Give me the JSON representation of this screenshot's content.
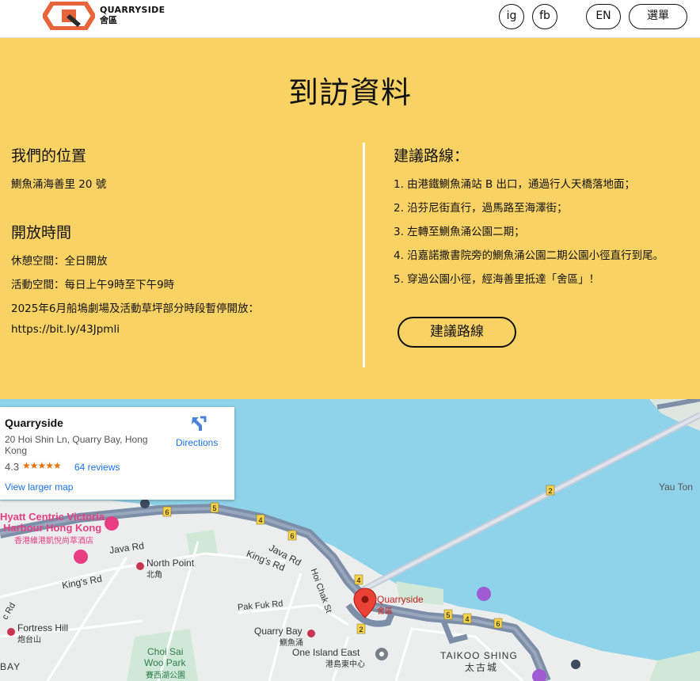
{
  "header": {
    "logo_line1": "QUARRYSIDE",
    "logo_line2": "舍區",
    "ig_label": "ig",
    "fb_label": "fb",
    "lang_label": "EN",
    "menu_label": "選單"
  },
  "info": {
    "title": "到訪資料",
    "location_heading": "我們的位置",
    "location_text": "鰂魚涌海善里 20 號",
    "hours_heading": "開放時間",
    "hours_lines": [
      "休憩空間：全日開放",
      "活動空間：每日上午9時至下午9時",
      "2025年6月船塢劇場及活動草坪部分時段暫停開放：",
      "https://bit.ly/43Jpmli"
    ],
    "route_heading": "建議路線：",
    "route_steps": [
      "1. 由港鐵鰂魚涌站 B 出口，通過行人天橋落地面；",
      "2. 沿芬尼街直行，過馬路至海澤街；",
      "3. 左轉至鰂魚涌公園二期；",
      "4. 沿嘉諾撒書院旁的鰂魚涌公園二期公園小徑直行到尾。",
      "5. 穿過公園小徑，經海善里抵達「舍區」！"
    ],
    "route_button": "建議路線"
  },
  "map": {
    "card": {
      "name": "Quarryside",
      "address": "20 Hoi Shin Ln, Quarry Bay, Hong Kong",
      "rating": "4.3",
      "stars": "★★★★★",
      "reviews": "64 reviews",
      "directions": "Directions",
      "larger_map": "View larger map"
    },
    "labels": {
      "hyatt_en1": "Hyatt Centric Victoria",
      "hyatt_en2": "Harbour Hong Kong",
      "hyatt_zh": "香港維港凱悅尚萃酒店",
      "java_rd_1": "Java Rd",
      "java_rd_2": "Java Rd",
      "kings_rd_1": "King's Rd",
      "kings_rd_2": "King's Rd",
      "north_point_en": "North Point",
      "north_point_zh": "北角",
      "hoi_chak_st": "Hoi Chak St",
      "pak_fuk_rd": "Pak Fuk Rd",
      "fortress_hill_en": "Fortress Hill",
      "fortress_hill_zh": "炮台山",
      "quarry_bay_en": "Quarry Bay",
      "quarry_bay_zh": "鰂魚涌",
      "quarryside_en": "Quarryside",
      "quarryside_zh": "舍區",
      "one_island_east_en": "One Island East",
      "one_island_east_zh": "港島東中心",
      "choi_sai_en1": "Choi Sai",
      "choi_sai_en2": "Woo Park",
      "choi_sai_zh": "賽西湖公園",
      "taikoo_shing_en": "TAIKOO SHING",
      "taikoo_shing_zh": "太古城",
      "yau_tong": "Yau Ton",
      "c_rd": "c Rd",
      "bay": "BAY"
    },
    "route_shields": [
      "6",
      "5",
      "4",
      "6",
      "4",
      "2",
      "5",
      "4",
      "6",
      "2"
    ],
    "colors": {
      "water": "#8fd3ea",
      "land": "#eceeee",
      "highway": "#7d8ea8",
      "pin": "#ea4335",
      "pin_label": "#c5221f",
      "poi_pink": "#e93d83"
    }
  }
}
